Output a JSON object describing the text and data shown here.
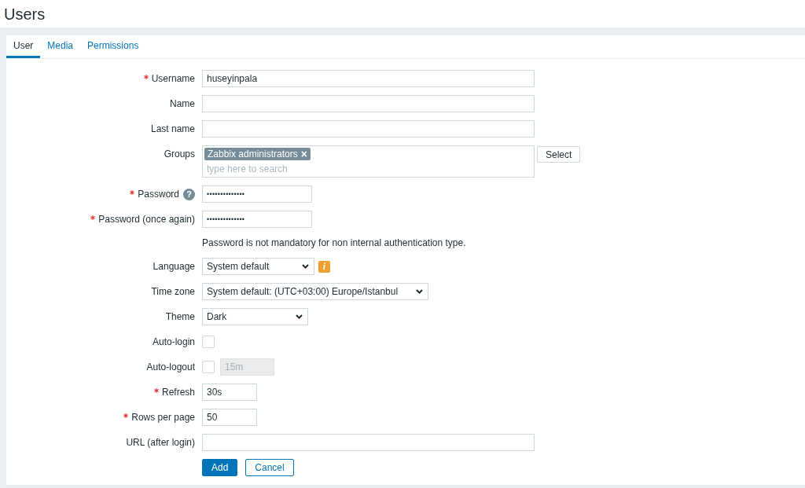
{
  "page_title": "Users",
  "tabs": [
    {
      "label": "User",
      "selected": true
    },
    {
      "label": "Media",
      "selected": false
    },
    {
      "label": "Permissions",
      "selected": false
    }
  ],
  "form": {
    "fields": [
      {
        "kind": "text",
        "label": "Username",
        "required": true,
        "value": "huseyinpala"
      },
      {
        "kind": "text",
        "label": "Name",
        "required": false
      },
      {
        "kind": "text",
        "label": "Last name",
        "required": false
      },
      {
        "kind": "multiselect",
        "label": "Groups",
        "required": false,
        "tags": [
          {
            "label": "Zabbix administrators",
            "remove": "×"
          }
        ],
        "placeholder": "type here to search",
        "button": "Select"
      },
      {
        "kind": "password",
        "label": "Password",
        "required": true,
        "value": "••••••••••••••",
        "help": "?"
      },
      {
        "kind": "password",
        "label": "Password (once again)",
        "required": true,
        "value": "••••••••••••••"
      },
      {
        "kind": "note",
        "text": "Password is not mandatory for non internal authentication type."
      },
      {
        "kind": "select",
        "label": "Language",
        "required": false,
        "value": "System default",
        "info": "i"
      },
      {
        "kind": "select",
        "label": "Time zone",
        "required": false,
        "value": "System default: (UTC+03:00) Europe/Istanbul"
      },
      {
        "kind": "select",
        "label": "Theme",
        "required": false,
        "value": "Dark"
      },
      {
        "kind": "checkbox",
        "label": "Auto-login",
        "required": false,
        "checked": false
      },
      {
        "kind": "checkbox",
        "label": "Auto-logout",
        "required": false,
        "checked": false,
        "input": {
          "value": "15m",
          "disabled": true
        }
      },
      {
        "kind": "text",
        "label": "Refresh",
        "required": true,
        "value": "30s"
      },
      {
        "kind": "text",
        "label": "Rows per page",
        "required": true,
        "value": "50"
      },
      {
        "kind": "text",
        "label": "URL (after login)",
        "required": false
      }
    ],
    "buttons": [
      {
        "label": "Add",
        "kind": "primary"
      },
      {
        "label": "Cancel",
        "kind": "secondary"
      }
    ]
  }
}
